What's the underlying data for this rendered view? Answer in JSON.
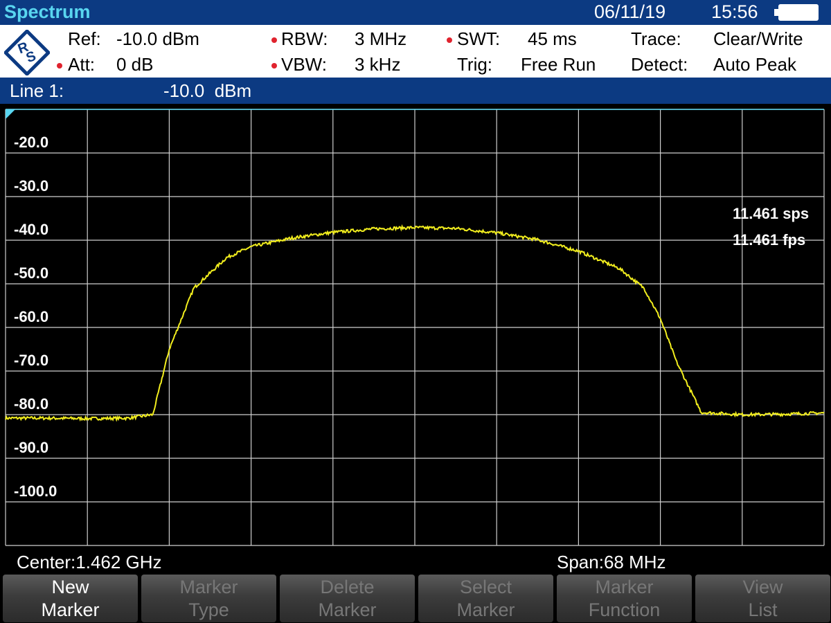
{
  "header": {
    "title": "Spectrum",
    "date": "06/11/19",
    "time": "15:56"
  },
  "settings": {
    "ref_label": "Ref:",
    "ref_value": "-10.0 dBm",
    "att_label": "Att:",
    "att_value": "0 dB",
    "rbw_label": "RBW:",
    "rbw_value": "3 MHz",
    "vbw_label": "VBW:",
    "vbw_value": "3 kHz",
    "swt_label": "SWT:",
    "swt_value": "45 ms",
    "trig_label": "Trig:",
    "trig_value": "Free Run",
    "trace_label": "Trace:",
    "trace_value": "Clear/Write",
    "detect_label": "Detect:",
    "detect_value": "Auto Peak"
  },
  "line": {
    "label": "Line 1:",
    "value": "-10.0  dBm"
  },
  "plot": {
    "y_labels": [
      "-20.0",
      "-30.0",
      "-40.0",
      "-50.0",
      "-60.0",
      "-70.0",
      "-80.0",
      "-90.0",
      "-100.0"
    ],
    "rate_sps": "11.461 sps",
    "rate_fps": "11.461 fps"
  },
  "chart_data": {
    "type": "line",
    "ylim": [
      -110,
      -10
    ],
    "xlim": [
      0,
      10
    ],
    "y_ticks": [
      -20,
      -30,
      -40,
      -50,
      -60,
      -70,
      -80,
      -90,
      -100
    ],
    "series": [
      {
        "x": [
          0,
          0.5,
          1.0,
          1.5,
          1.8,
          2.0,
          2.3,
          2.7,
          3.0,
          3.5,
          4.0,
          4.5,
          5.0,
          5.5,
          6.0,
          6.5,
          7.0,
          7.5,
          7.8,
          8.0,
          8.2,
          8.5,
          9.0,
          9.5,
          10.0
        ],
        "y": [
          -80.8,
          -80.8,
          -80.9,
          -80.8,
          -80.0,
          -65.0,
          -51.0,
          -44.0,
          -41.5,
          -39.5,
          -38.2,
          -37.4,
          -37.1,
          -37.3,
          -38.3,
          -39.9,
          -42.5,
          -46.5,
          -51.0,
          -58.0,
          -68.0,
          -79.5,
          -80.0,
          -79.9,
          -79.6
        ],
        "color": "#f2ee1e"
      }
    ],
    "reference_line": -10,
    "grid": true
  },
  "status": {
    "center": "Center:1.462 GHz",
    "span": "Span:68 MHz"
  },
  "softkeys": [
    {
      "line1": "New",
      "line2": "Marker"
    },
    {
      "line1": "Marker",
      "line2": "Type"
    },
    {
      "line1": "Delete",
      "line2": "Marker"
    },
    {
      "line1": "Select",
      "line2": "Marker"
    },
    {
      "line1": "Marker",
      "line2": "Function"
    },
    {
      "line1": "View",
      "line2": "List"
    }
  ],
  "colors": {
    "header_bg": "#0c3a82",
    "title": "#59d6f0",
    "trace": "#f2ee1e",
    "marker_dot": "#e0232e"
  }
}
